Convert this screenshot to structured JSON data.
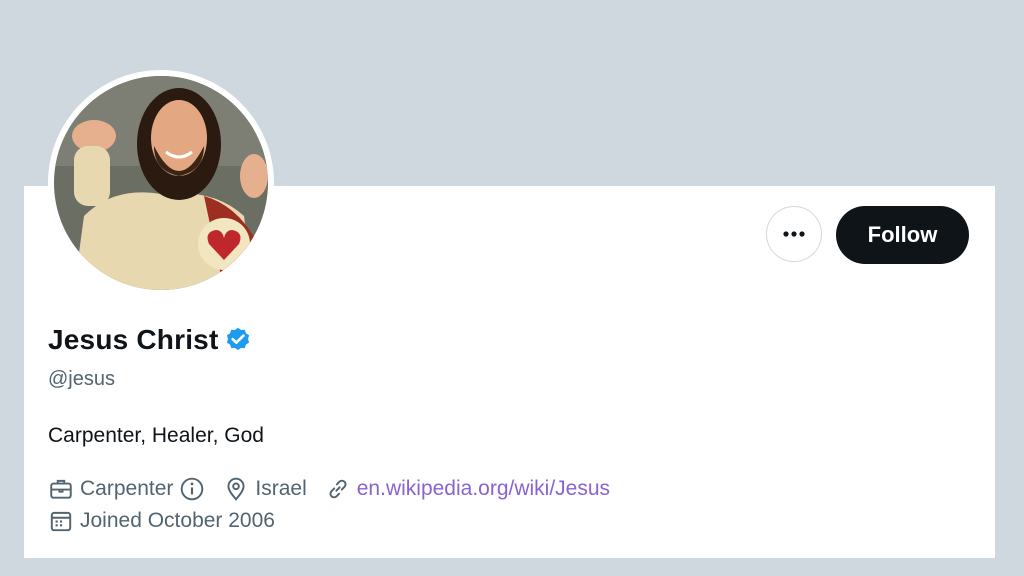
{
  "profile": {
    "name": "Jesus Christ",
    "handle": "@jesus",
    "bio": "Carpenter, Healer, God",
    "verified": true
  },
  "actions": {
    "more_label": "···",
    "follow_label": "Follow"
  },
  "meta": {
    "profession": "Carpenter",
    "location": "Israel",
    "website": "en.wikipedia.org/wiki/Jesus",
    "joined": "Joined October 2006"
  },
  "colors": {
    "banner": "#d0d8df",
    "verified_badge": "#1d9bf0",
    "link": "#8a63d2",
    "follow_bg": "#0f1419"
  },
  "icons": {
    "more": "more-horizontal-icon",
    "verified": "verified-badge-icon",
    "profession": "briefcase-icon",
    "info": "info-icon",
    "location": "location-pin-icon",
    "link": "link-icon",
    "joined": "calendar-icon"
  }
}
